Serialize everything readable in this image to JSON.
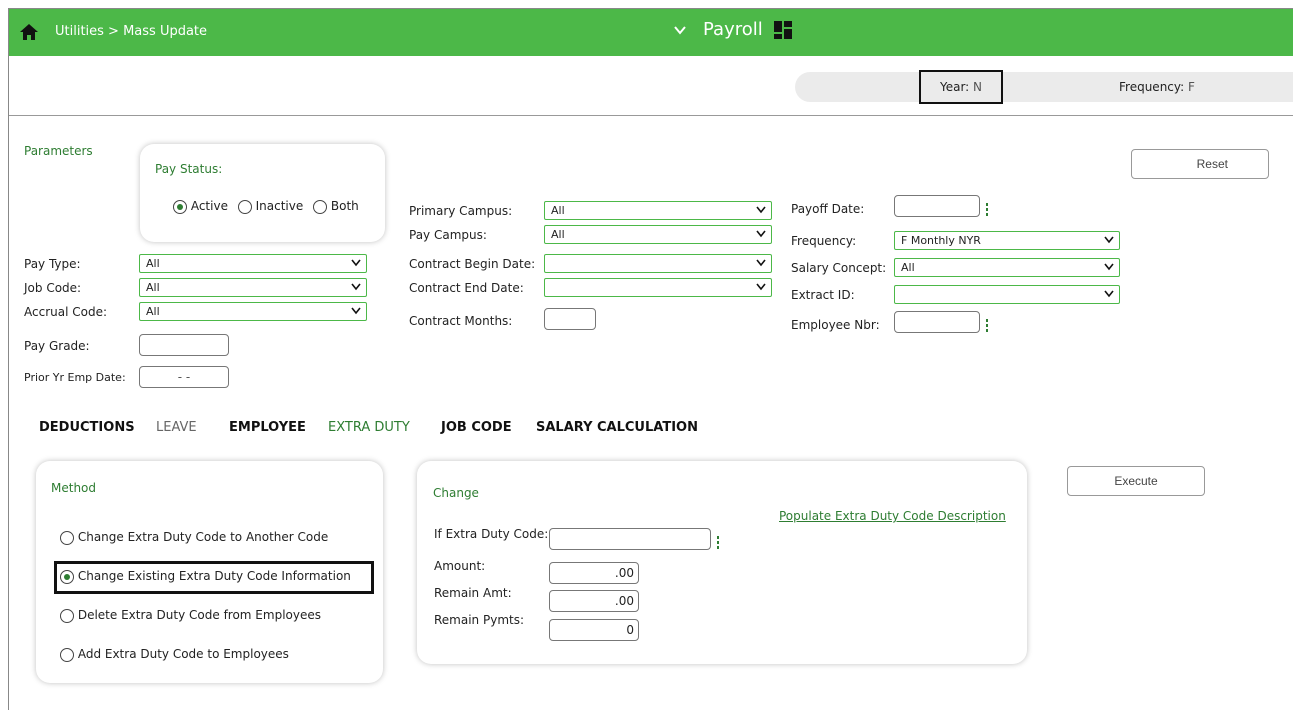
{
  "header": {
    "breadcrumb": "Utilities > Mass Update",
    "module": "Payroll"
  },
  "status": {
    "year_label": "Year:",
    "year_value": "N",
    "freq_label": "Frequency:",
    "freq_value": "F"
  },
  "parameters": {
    "title": "Parameters",
    "pay_status": {
      "label": "Pay Status:",
      "options": [
        "Active",
        "Inactive",
        "Both"
      ],
      "selected": "Active"
    },
    "pay_type": {
      "label": "Pay Type:",
      "value": "All"
    },
    "job_code": {
      "label": "Job Code:",
      "value": "All"
    },
    "accrual_code": {
      "label": "Accrual Code:",
      "value": "All"
    },
    "pay_grade": {
      "label": "Pay Grade:",
      "value": ""
    },
    "prior_yr": {
      "label": "Prior Yr Emp Date:",
      "value": "- -"
    },
    "primary_campus": {
      "label": "Primary Campus:",
      "value": "All"
    },
    "pay_campus": {
      "label": "Pay Campus:",
      "value": "All"
    },
    "contract_begin": {
      "label": "Contract Begin Date:",
      "value": ""
    },
    "contract_end": {
      "label": "Contract End Date:",
      "value": ""
    },
    "contract_months": {
      "label": "Contract Months:",
      "value": ""
    },
    "payoff_date": {
      "label": "Payoff Date:",
      "value": ""
    },
    "frequency": {
      "label": "Frequency:",
      "value": "F Monthly NYR"
    },
    "salary_concept": {
      "label": "Salary Concept:",
      "value": "All"
    },
    "extract_id": {
      "label": "Extract ID:",
      "value": ""
    },
    "employee_nbr": {
      "label": "Employee Nbr:",
      "value": ""
    },
    "reset_label": "Reset"
  },
  "tabs": [
    "DEDUCTIONS",
    "LEAVE",
    "EMPLOYEE",
    "EXTRA DUTY",
    "JOB CODE",
    "SALARY CALCULATION"
  ],
  "method": {
    "title": "Method",
    "options": [
      "Change Extra Duty Code to Another Code",
      "Change Existing Extra Duty Code Information",
      "Delete Extra Duty Code from Employees",
      "Add Extra Duty Code to Employees"
    ],
    "selected_index": 1
  },
  "change": {
    "title": "Change",
    "link": "Populate Extra Duty Code Description",
    "if_code_label": "If Extra Duty Code:",
    "if_code_value": "",
    "amount_label": "Amount:",
    "amount_value": ".00",
    "remain_amt_label": "Remain Amt:",
    "remain_amt_value": ".00",
    "remain_pymts_label": "Remain Pymts:",
    "remain_pymts_value": "0"
  },
  "execute_label": "Execute",
  "colors": {
    "brand": "#4cb848",
    "accent": "#2e7d32"
  }
}
